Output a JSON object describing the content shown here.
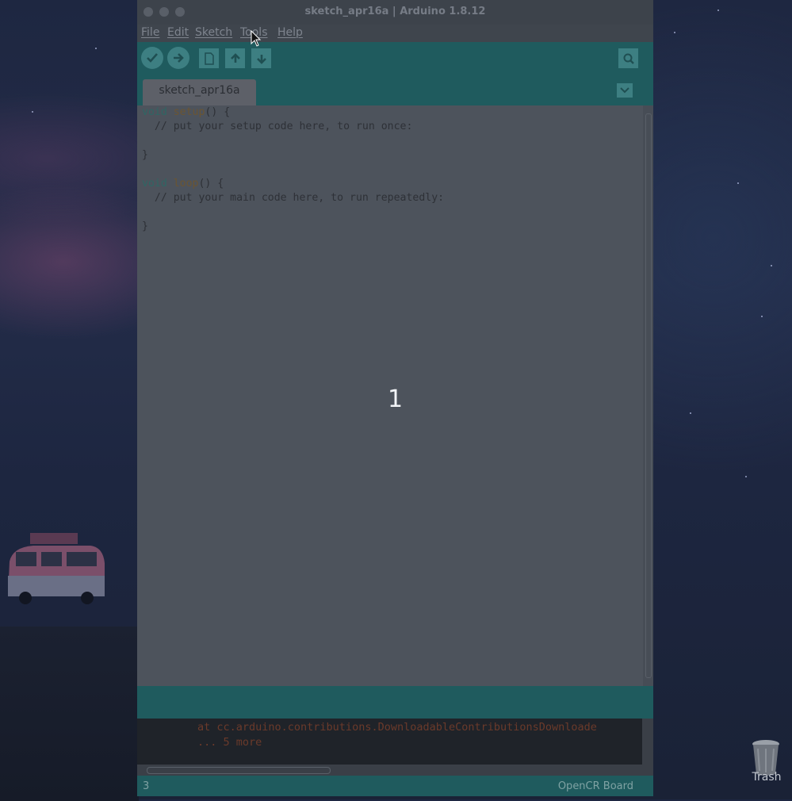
{
  "desktop": {
    "trash_label": "Trash"
  },
  "window": {
    "title": "sketch_apr16a | Arduino 1.8.12",
    "menu": [
      "File",
      "Edit",
      "Sketch",
      "Tools",
      "Help"
    ],
    "tab_name": "sketch_apr16a",
    "code": [
      {
        "kw": "void ",
        "fn": "setup",
        "rest": "() {"
      },
      {
        "cm": "  // put your setup code here, to run once:"
      },
      {
        "text": ""
      },
      {
        "text": "}"
      },
      {
        "text": ""
      },
      {
        "kw": "void ",
        "fn": "loop",
        "rest": "() {"
      },
      {
        "cm": "  // put your main code here, to run repeatedly:"
      },
      {
        "text": ""
      },
      {
        "text": "}"
      }
    ],
    "overlay_number": "1",
    "console_lines": [
      "at cc.arduino.contributions.DownloadableContributionsDownloade",
      "... 5 more"
    ],
    "status_line_number": "3",
    "board_name": "OpenCR Board"
  },
  "colors": {
    "toolbar_teal": "#1f5b5e",
    "editor_bg": "#4d535c",
    "console_bg": "#1f2329"
  },
  "icons": [
    "verify-icon",
    "upload-icon",
    "new-icon",
    "open-icon",
    "save-icon",
    "serial-monitor-icon",
    "tab-menu-icon",
    "trash-icon",
    "mouse-cursor-icon"
  ]
}
